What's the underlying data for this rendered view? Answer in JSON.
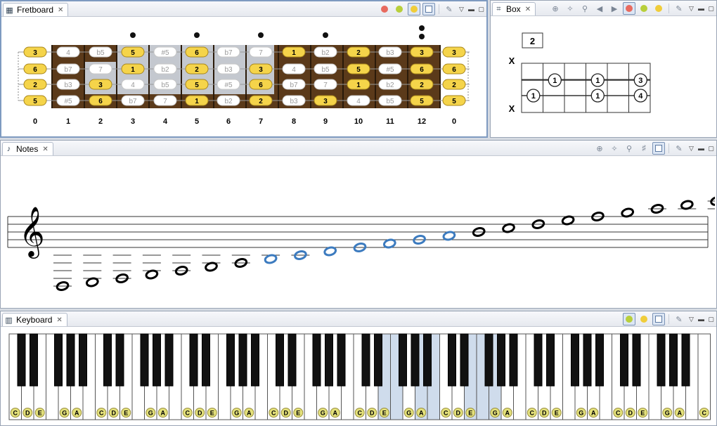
{
  "fretboard": {
    "tab_label": "Fretboard",
    "fret_numbers": [
      "0",
      "1",
      "2",
      "3",
      "4",
      "5",
      "6",
      "7",
      "8",
      "9",
      "10",
      "11",
      "12",
      "0"
    ],
    "strings": [
      [
        "3",
        "4",
        "b5",
        "5",
        "#5",
        "6",
        "b7",
        "7",
        "1",
        "b2",
        "2",
        "b3",
        "3",
        "3"
      ],
      [
        "6",
        "b7",
        "7",
        "1",
        "b2",
        "2",
        "b3",
        "3",
        "4",
        "b5",
        "5",
        "#5",
        "6",
        "6"
      ],
      [
        "2",
        "b3",
        "3",
        "4",
        "b5",
        "5",
        "#5",
        "6",
        "b7",
        "7",
        "1",
        "b2",
        "2",
        "2"
      ],
      [
        "5",
        "#5",
        "6",
        "b7",
        "7",
        "1",
        "b2",
        "2",
        "b3",
        "3",
        "4",
        "b5",
        "5",
        "5"
      ]
    ],
    "highlighted_values": [
      "1",
      "2",
      "3",
      "5",
      "6"
    ],
    "position_markers": "3, 5, 7, 9, double at 12",
    "shaded_position": "frets 2–7"
  },
  "box": {
    "tab_label": "Box",
    "position_number": "2",
    "string_marks": [
      "X",
      "X"
    ],
    "cells": [
      {
        "row": 0,
        "col": 1,
        "label": "1"
      },
      {
        "row": 0,
        "col": 3,
        "label": "1"
      },
      {
        "row": 0,
        "col": 5,
        "label": "3"
      },
      {
        "row": 1,
        "col": 0,
        "label": "1"
      },
      {
        "row": 1,
        "col": 3,
        "label": "1"
      },
      {
        "row": 1,
        "col": 5,
        "label": "4"
      }
    ]
  },
  "notes": {
    "tab_label": "Notes",
    "clef": "treble",
    "note_count": 24,
    "highlight_color": "#3c7bbf"
  },
  "keyboard": {
    "tab_label": "Keyboard",
    "octave_labels": [
      "C",
      "D",
      "E",
      "G",
      "A"
    ],
    "octaves": 9,
    "highlight_color": "#cfdcec"
  },
  "colors": {
    "accent_yellow": "#f5d44a",
    "wood": "#5b3a1a",
    "active_border": "#7e9ac0"
  },
  "toolbar": {
    "red_dot": "#e86a5f",
    "green_dot": "#b8cf3b",
    "yellow_dot": "#f0cd3a"
  }
}
